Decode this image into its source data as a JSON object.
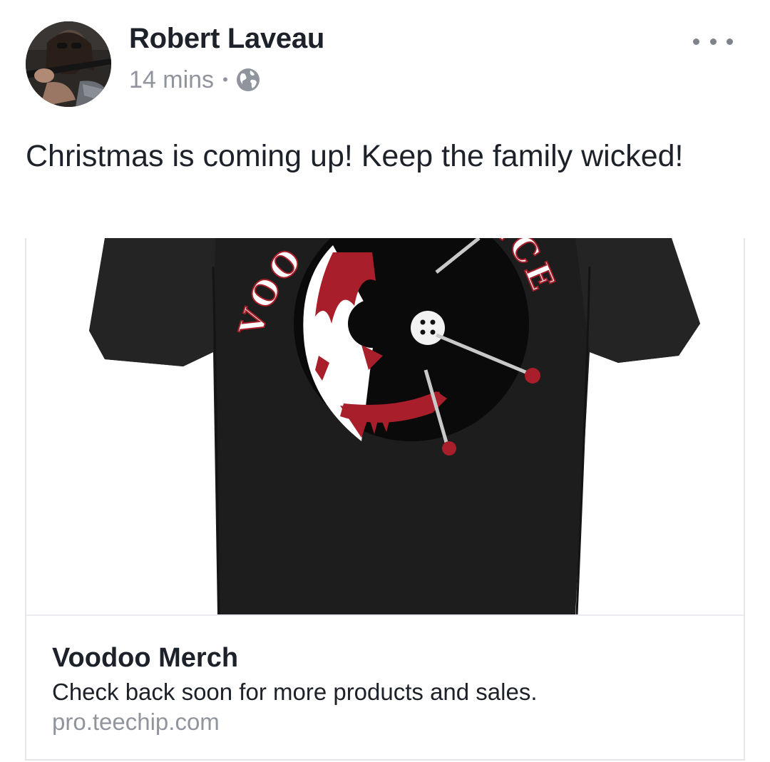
{
  "post": {
    "author_name": "Robert Laveau",
    "timestamp": "14 mins",
    "separator": "•",
    "privacy_icon": "globe-icon",
    "menu_icon": "more-options-icon",
    "text": "Christmas is coming up!  Keep the family wicked!"
  },
  "link_preview": {
    "image_subject": "black t-shirt with voodoo doll graphic",
    "shirt_text_left": "VOO",
    "shirt_text_right": "NCE",
    "title": "Voodoo Merch",
    "description": "Check back soon for more products and sales.",
    "domain": "pro.teechip.com"
  },
  "colors": {
    "author": "#1d2129",
    "meta": "#90949c",
    "shirt": "#1c1c1c",
    "blood_red": "#a81e2a",
    "border": "#e4e6ea"
  }
}
